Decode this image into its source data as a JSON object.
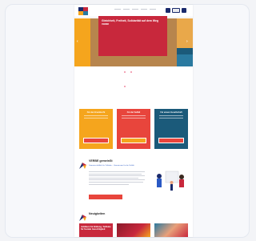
{
  "colors": {
    "brand_navy": "#1a2a6c",
    "brand_red": "#c8283c",
    "brand_orange": "#f5a51d",
    "brand_blue": "#1b5a7a",
    "accent_red_button": "#e8453c",
    "link_blue": "#2a59c4"
  },
  "header": {
    "logo_icon": "multicolor-logo-icon",
    "search_icon": "search-icon",
    "user_icon": "user-icon"
  },
  "hero": {
    "title": "Gleichheit, Freiheit, Solidarität auf dem Weg voran",
    "prev_icon": "chevron-left-icon",
    "next_icon": "chevron-right-icon",
    "slide_count": 4,
    "active_slide": 3
  },
  "tiles": [
    {
      "title": "Für den Grundrecht"
    },
    {
      "title": "Für die Vielfalt"
    },
    {
      "title": "Für unsere Gesellschaft"
    }
  ],
  "about": {
    "title": "VERBE gemeinSt",
    "subtitle": "Gemeinschaftlich für Teilhabe – Gemeinsam für die Vielfalt",
    "illustration_icon": "people-illustration-icon"
  },
  "news": {
    "title": "Neuigkeiten",
    "items": [
      {
        "caption": "Jubiläum für Bildung, Teilhabe für Soziale Gerechtigkeit"
      },
      {
        "caption": ""
      },
      {
        "caption": ""
      }
    ]
  }
}
